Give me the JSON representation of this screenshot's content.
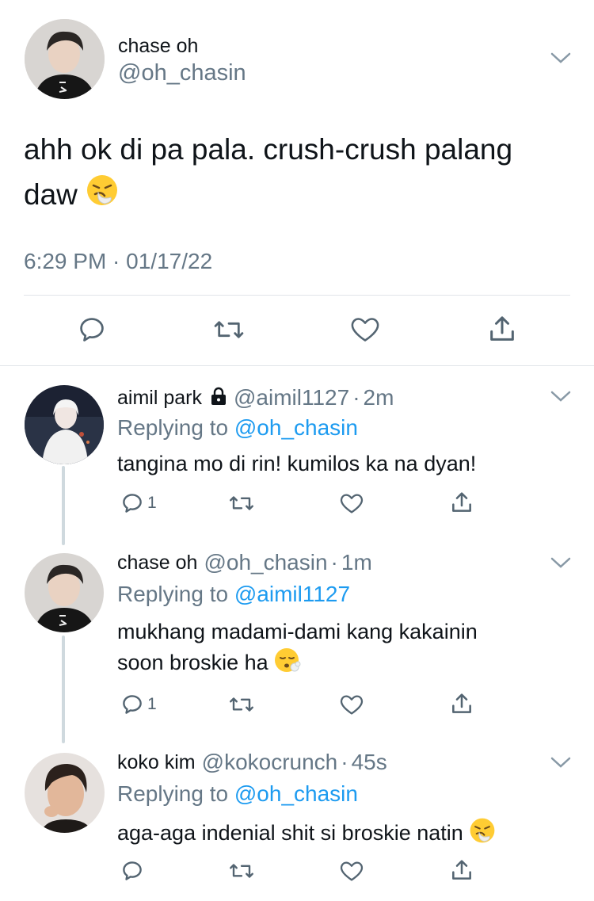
{
  "main_tweet": {
    "name": "chase oh",
    "handle": "@oh_chasin",
    "text": "ahh ok di pa pala. crush-crush palang daw",
    "emoji": "sneezing-face",
    "timestamp": "6:29 PM · 01/17/22"
  },
  "replies": [
    {
      "name": "aimil park",
      "locked": true,
      "handle": "@aimil1127",
      "time": "2m",
      "replying_label": "Replying to",
      "replying_to": "@oh_chasin",
      "text": "tangina mo di rin! kumilos ka na dyan!",
      "reply_count": "1"
    },
    {
      "name": "chase oh",
      "handle": "@oh_chasin",
      "time": "1m",
      "replying_label": "Replying to",
      "replying_to": "@aimil1127",
      "text_line1": "mukhang madami-dami kang kakainin",
      "text_line2": "soon broskie ha",
      "emoji": "face-exhaling",
      "reply_count": "1"
    },
    {
      "name": "koko kim",
      "handle": "@kokocrunch",
      "time": "45s",
      "replying_label": "Replying to",
      "replying_to": "@oh_chasin",
      "text": "aga-aga indenial shit si broskie natin",
      "emoji": "sneezing-face"
    }
  ],
  "colors": {
    "link": "#1d9bf0",
    "secondary_text": "#657786",
    "icon": "#536471",
    "divider": "#e1e5e9"
  }
}
